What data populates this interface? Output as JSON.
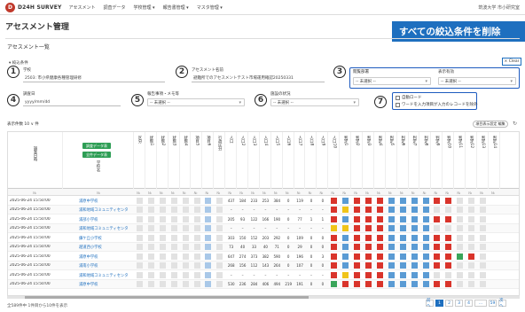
{
  "topbar": {
    "logo_mark": "D",
    "logo_text": "D24H SURVEY",
    "nav": [
      "アセスメント",
      "調査データ",
      "学校管理 ▾",
      "報告書管理 ▾",
      "マスタ管理 ▾"
    ],
    "user": "筑波大学 市小研究室"
  },
  "banner": "すべての絞込条件を削除",
  "page_title": "アセスメント管理",
  "section_title": "アセスメント一覧",
  "clear_label": "× Clear",
  "filter_toggle": "▾ 絞込条件",
  "markers": [
    "1",
    "2",
    "3",
    "4",
    "5",
    "6",
    "7"
  ],
  "filters": {
    "school_label": "学校",
    "school_value": "2503: 市小県健康各種管理研修",
    "name_label": "アセスメント名前",
    "name_value": "避難所でのアセスメントテスト市場運用確認20250331",
    "doc_label": "閲覧部署",
    "doc_value": "-- 未選択 --",
    "target_label": "表示有効",
    "target_value": "-- 未選択 --",
    "date_label": "調査日",
    "date_placeholder": "yyyy/mm/dd",
    "report_label": "報告事項・メモ等",
    "report_value": "-- 未選択 --",
    "status_label": "施設の状況",
    "status_value": "-- 未選択 --",
    "check1": "自動ロード",
    "check2": "ワードを入力した項目がある場合",
    "check2_full": "ワードを入力項目が入力のレコードを除外"
  },
  "table_ctrl": "表示件数  10  ∨  件",
  "csv_label": "項目表示設定 編集",
  "btn_green1": "調査データ表",
  "btn_green2": "全件データ表",
  "col_school": "学校名",
  "headers": [
    "調査日時",
    "学校名",
    "区分",
    "状態1",
    "状態2",
    "状態3",
    "状態4",
    "項目5",
    "項目6",
    "行政区分",
    "人口",
    "人口2",
    "人口3",
    "人口4",
    "人口5",
    "人口6",
    "人口7",
    "人口8",
    "人口9",
    "人口10",
    "判定1",
    "判定2",
    "判定3",
    "判定4",
    "判定5",
    "判定6",
    "判定7",
    "判定8",
    "判定9",
    "判定10",
    "判定11",
    "判定12",
    "判定13",
    "判定14"
  ],
  "rows": [
    {
      "date": "2025-06-24 15:50:00",
      "school": "浦原中学校",
      "nums": [
        "437",
        "184",
        "233",
        "253",
        "384",
        "0",
        "119",
        "0",
        "0"
      ]
    },
    {
      "date": "2025-06-24 15:50:00",
      "school": "浦和地域コミュニティセンター",
      "nums": [
        "–",
        "–",
        "–",
        "–",
        "–",
        "–",
        "–",
        "–",
        "–"
      ]
    },
    {
      "date": "2025-06-24 15:50:00",
      "school": "浦部小学校",
      "nums": [
        "205",
        "93",
        "122",
        "166",
        "190",
        "0",
        "77",
        "1",
        "1"
      ]
    },
    {
      "date": "2025-06-24 15:50:00",
      "school": "浦和地域コミュニティセンター",
      "nums": [
        "–",
        "–",
        "–",
        "–",
        "–",
        "–",
        "–",
        "–",
        "–"
      ]
    },
    {
      "date": "2025-06-24 15:50:00",
      "school": "鎌ケ丘小学校",
      "nums": [
        "303",
        "150",
        "152",
        "203",
        "292",
        "0",
        "109",
        "0",
        "0"
      ]
    },
    {
      "date": "2025-06-24 15:50:00",
      "school": "越道西小学校",
      "nums": [
        "73",
        "40",
        "33",
        "40",
        "71",
        "0",
        "29",
        "0",
        "0"
      ]
    },
    {
      "date": "2025-06-24 15:50:00",
      "school": "浦原中学校",
      "nums": [
        "647",
        "274",
        "373",
        "382",
        "590",
        "0",
        "196",
        "0",
        "3"
      ]
    },
    {
      "date": "2025-06-24 15:50:00",
      "school": "浦南小学校",
      "nums": [
        "268",
        "156",
        "112",
        "143",
        "264",
        "0",
        "107",
        "0",
        "0"
      ]
    },
    {
      "date": "2025-06-24 15:50:00",
      "school": "浦和地域コミュニティセンター",
      "nums": [
        "–",
        "–",
        "–",
        "–",
        "–",
        "–",
        "–",
        "–",
        "–"
      ]
    },
    {
      "date": "2025-06-24 15:50:00",
      "school": "浦原中学校",
      "nums": [
        "530",
        "236",
        "284",
        "406",
        "494",
        "219",
        "191",
        "0",
        "0"
      ]
    }
  ],
  "footer": "全589件中 1件目から10件を表示",
  "pager": [
    "前へ",
    "1",
    "2",
    "3",
    "4",
    "...",
    "59",
    "次へ"
  ],
  "colors": {
    "red": "#d9342b",
    "blue": "#5a9bd4",
    "yellow": "#f0c419",
    "green": "#3aa55a",
    "lightblue": "#a9c8e8",
    "gray": "#cfcfcf"
  }
}
